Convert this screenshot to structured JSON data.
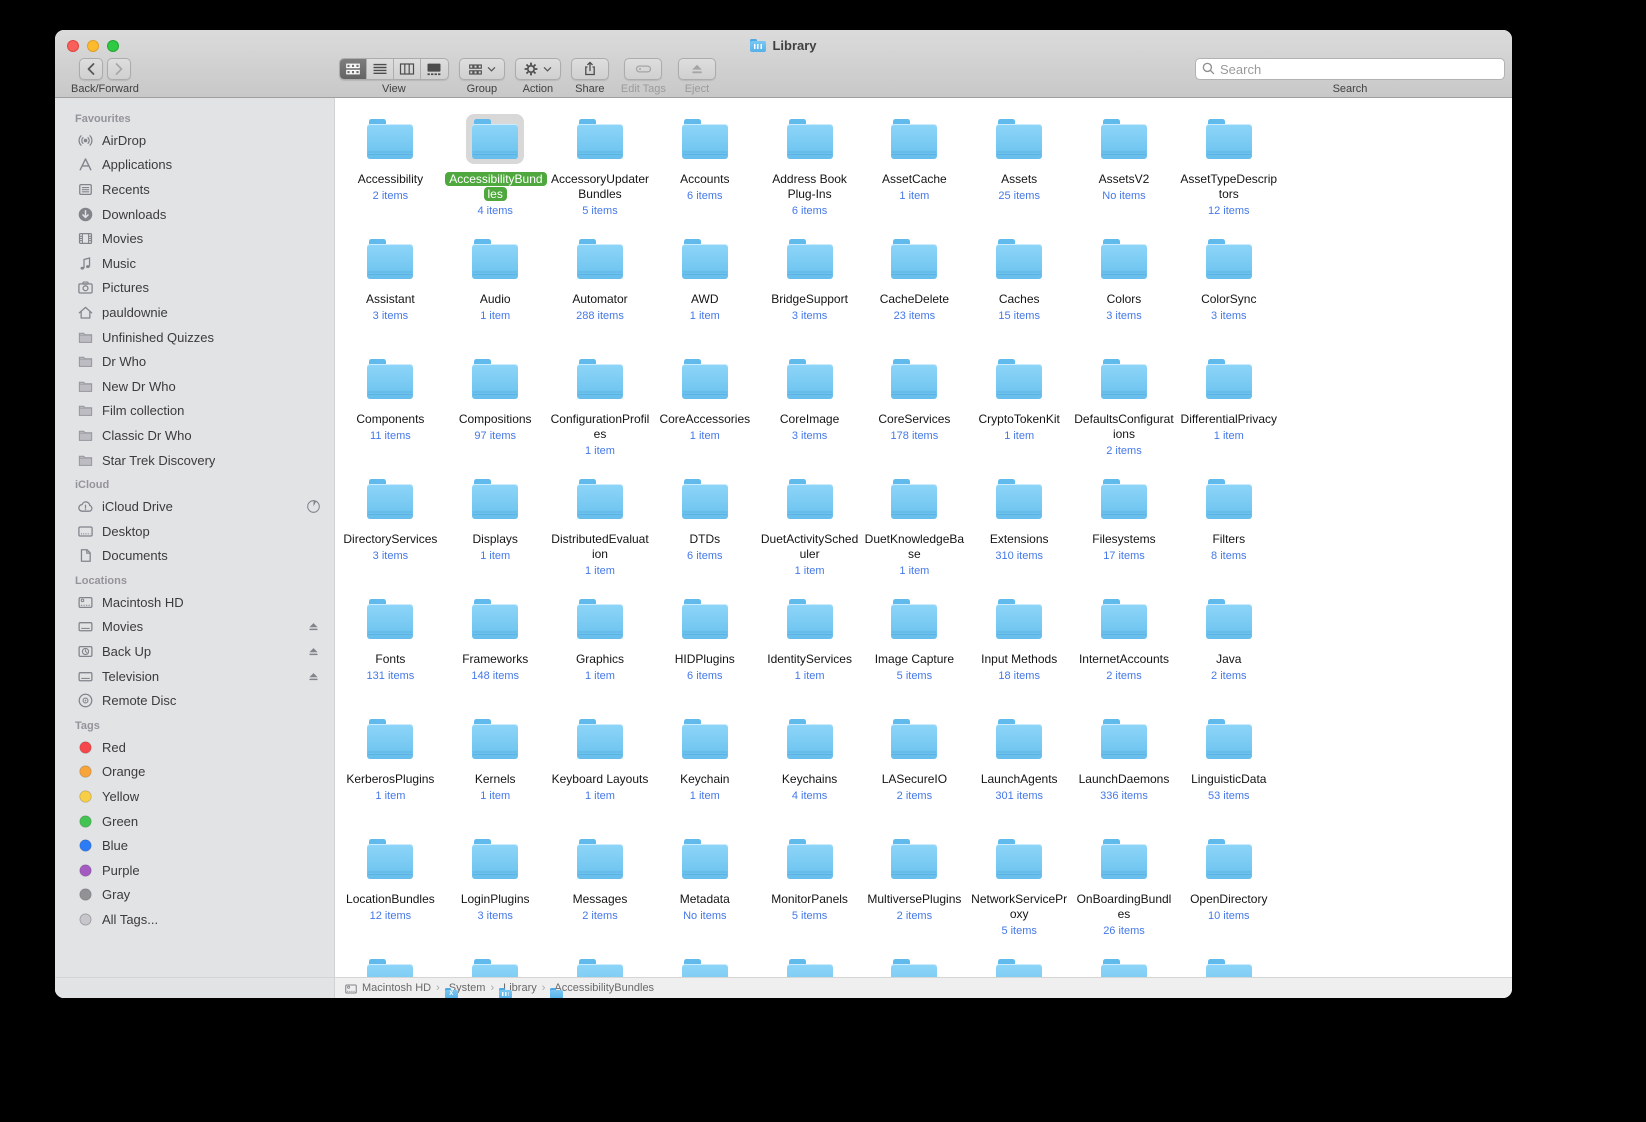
{
  "window": {
    "title": "Library"
  },
  "toolbar": {
    "back_forward_label": "Back/Forward",
    "view_label": "View",
    "group_label": "Group",
    "action_label": "Action",
    "share_label": "Share",
    "edit_tags_label": "Edit Tags",
    "eject_label": "Eject",
    "search_label": "Search",
    "search_placeholder": "Search"
  },
  "colors": {
    "folder_blue": "#6fc5f1",
    "selection_label_green": "#4fa83d",
    "item_count_blue": "#4478e8",
    "sidebar_bg": "#e2e3e5",
    "toolbar_selected_segment": "#6e6e6e"
  },
  "sidebar": {
    "sections": [
      {
        "title": "Favourites",
        "items": [
          {
            "label": "AirDrop",
            "icon": "airdrop"
          },
          {
            "label": "Applications",
            "icon": "applications"
          },
          {
            "label": "Recents",
            "icon": "recents"
          },
          {
            "label": "Downloads",
            "icon": "downloads"
          },
          {
            "label": "Movies",
            "icon": "movies"
          },
          {
            "label": "Music",
            "icon": "music"
          },
          {
            "label": "Pictures",
            "icon": "pictures"
          },
          {
            "label": "pauldownie",
            "icon": "home"
          },
          {
            "label": "Unfinished Quizzes",
            "icon": "folder"
          },
          {
            "label": "Dr Who",
            "icon": "folder"
          },
          {
            "label": "New Dr Who",
            "icon": "folder"
          },
          {
            "label": "Film collection",
            "icon": "folder"
          },
          {
            "label": "Classic Dr Who",
            "icon": "folder"
          },
          {
            "label": "Star Trek Discovery",
            "icon": "folder"
          }
        ]
      },
      {
        "title": "iCloud",
        "items": [
          {
            "label": "iCloud Drive",
            "icon": "cloud",
            "trailing": "progress"
          },
          {
            "label": "Desktop",
            "icon": "desktop"
          },
          {
            "label": "Documents",
            "icon": "documents"
          }
        ]
      },
      {
        "title": "Locations",
        "items": [
          {
            "label": "Macintosh HD",
            "icon": "hdd"
          },
          {
            "label": "Movies",
            "icon": "external",
            "trailing": "eject"
          },
          {
            "label": "Back Up",
            "icon": "timemachine",
            "trailing": "eject"
          },
          {
            "label": "Television",
            "icon": "external",
            "trailing": "eject"
          },
          {
            "label": "Remote Disc",
            "icon": "disc"
          }
        ]
      },
      {
        "title": "Tags",
        "items": [
          {
            "label": "Red",
            "icon": "tag",
            "color": "#F5484D"
          },
          {
            "label": "Orange",
            "icon": "tag",
            "color": "#F7A43B"
          },
          {
            "label": "Yellow",
            "icon": "tag",
            "color": "#F8CE47"
          },
          {
            "label": "Green",
            "icon": "tag",
            "color": "#43C352"
          },
          {
            "label": "Blue",
            "icon": "tag",
            "color": "#2D7CF6"
          },
          {
            "label": "Purple",
            "icon": "tag",
            "color": "#A35BC2"
          },
          {
            "label": "Gray",
            "icon": "tag",
            "color": "#919196"
          },
          {
            "label": "All Tags...",
            "icon": "alltags"
          }
        ]
      }
    ]
  },
  "grid": {
    "partial_row_count": 9,
    "folders": [
      {
        "name": "Accessibility",
        "info": "2 items"
      },
      {
        "name": "AccessibilityBundles",
        "info": "4 items",
        "selected": true
      },
      {
        "name": "AccessoryUpdaterBundles",
        "info": "5 items"
      },
      {
        "name": "Accounts",
        "info": "6 items"
      },
      {
        "name": "Address Book Plug-Ins",
        "info": "6 items"
      },
      {
        "name": "AssetCache",
        "info": "1 item"
      },
      {
        "name": "Assets",
        "info": "25 items"
      },
      {
        "name": "AssetsV2",
        "info": "No items"
      },
      {
        "name": "AssetTypeDescriptors",
        "info": "12 items"
      },
      {
        "name": "Assistant",
        "info": "3 items"
      },
      {
        "name": "Audio",
        "info": "1 item"
      },
      {
        "name": "Automator",
        "info": "288 items"
      },
      {
        "name": "AWD",
        "info": "1 item"
      },
      {
        "name": "BridgeSupport",
        "info": "3 items"
      },
      {
        "name": "CacheDelete",
        "info": "23 items"
      },
      {
        "name": "Caches",
        "info": "15 items"
      },
      {
        "name": "Colors",
        "info": "3 items"
      },
      {
        "name": "ColorSync",
        "info": "3 items"
      },
      {
        "name": "Components",
        "info": "11 items"
      },
      {
        "name": "Compositions",
        "info": "97 items"
      },
      {
        "name": "ConfigurationProfiles",
        "info": "1 item"
      },
      {
        "name": "CoreAccessories",
        "info": "1 item"
      },
      {
        "name": "CoreImage",
        "info": "3 items"
      },
      {
        "name": "CoreServices",
        "info": "178 items"
      },
      {
        "name": "CryptoTokenKit",
        "info": "1 item"
      },
      {
        "name": "DefaultsConfigurations",
        "info": "2 items"
      },
      {
        "name": "DifferentialPrivacy",
        "info": "1 item"
      },
      {
        "name": "DirectoryServices",
        "info": "3 items"
      },
      {
        "name": "Displays",
        "info": "1 item"
      },
      {
        "name": "DistributedEvaluation",
        "info": "1 item"
      },
      {
        "name": "DTDs",
        "info": "6 items"
      },
      {
        "name": "DuetActivityScheduler",
        "info": "1 item"
      },
      {
        "name": "DuetKnowledgeBase",
        "info": "1 item"
      },
      {
        "name": "Extensions",
        "info": "310 items"
      },
      {
        "name": "Filesystems",
        "info": "17 items"
      },
      {
        "name": "Filters",
        "info": "8 items"
      },
      {
        "name": "Fonts",
        "info": "131 items"
      },
      {
        "name": "Frameworks",
        "info": "148 items"
      },
      {
        "name": "Graphics",
        "info": "1 item"
      },
      {
        "name": "HIDPlugins",
        "info": "6 items"
      },
      {
        "name": "IdentityServices",
        "info": "1 item"
      },
      {
        "name": "Image Capture",
        "info": "5 items"
      },
      {
        "name": "Input Methods",
        "info": "18 items"
      },
      {
        "name": "InternetAccounts",
        "info": "2 items"
      },
      {
        "name": "Java",
        "info": "2 items"
      },
      {
        "name": "KerberosPlugins",
        "info": "1 item"
      },
      {
        "name": "Kernels",
        "info": "1 item"
      },
      {
        "name": "Keyboard Layouts",
        "info": "1 item"
      },
      {
        "name": "Keychain",
        "info": "1 item"
      },
      {
        "name": "Keychains",
        "info": "4 items"
      },
      {
        "name": "LASecureIO",
        "info": "2 items"
      },
      {
        "name": "LaunchAgents",
        "info": "301 items"
      },
      {
        "name": "LaunchDaemons",
        "info": "336 items"
      },
      {
        "name": "LinguisticData",
        "info": "53 items"
      },
      {
        "name": "LocationBundles",
        "info": "12 items"
      },
      {
        "name": "LoginPlugins",
        "info": "3 items"
      },
      {
        "name": "Messages",
        "info": "2 items"
      },
      {
        "name": "Metadata",
        "info": "No items"
      },
      {
        "name": "MonitorPanels",
        "info": "5 items"
      },
      {
        "name": "MultiversePlugins",
        "info": "2 items"
      },
      {
        "name": "NetworkServiceProxy",
        "info": "5 items"
      },
      {
        "name": "OnBoardingBundles",
        "info": "26 items"
      },
      {
        "name": "OpenDirectory",
        "info": "10 items"
      }
    ]
  },
  "pathbar": {
    "items": [
      {
        "label": "Macintosh HD",
        "icon": "hdd"
      },
      {
        "label": "System",
        "icon": "system-folder"
      },
      {
        "label": "Library",
        "icon": "library-folder"
      },
      {
        "label": "AccessibilityBundles",
        "icon": "folder"
      }
    ]
  }
}
